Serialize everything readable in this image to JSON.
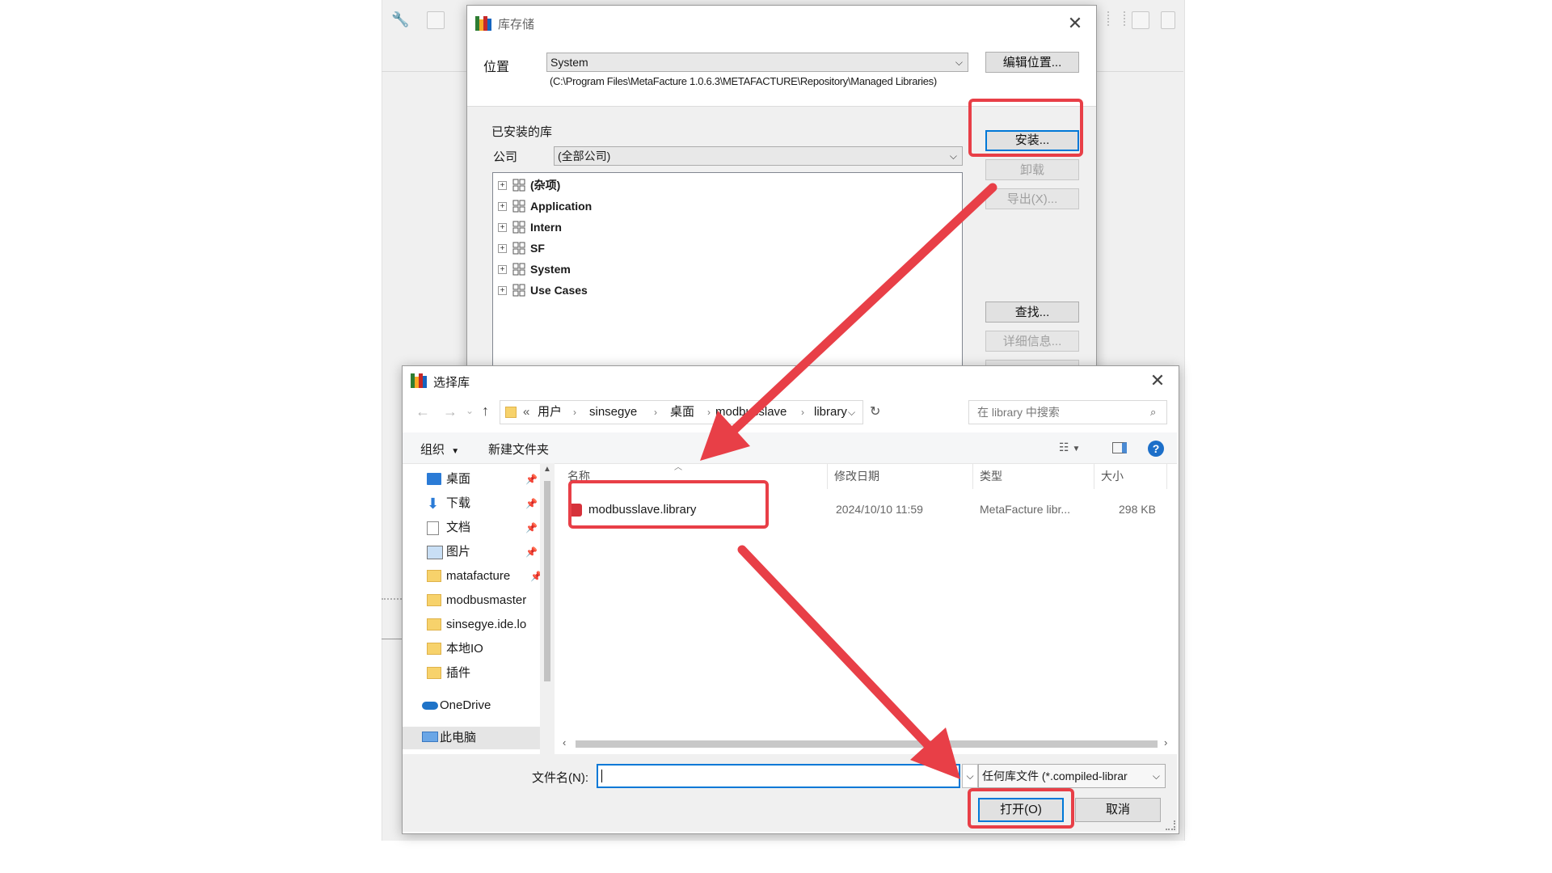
{
  "lib_dialog": {
    "title": "库存储",
    "location_label": "位置",
    "location_value": "System",
    "location_path": "(C:\\Program Files\\MetaFacture 1.0.6.3\\METAFACTURE\\Repository\\Managed Libraries)",
    "edit_location_button": "编辑位置...",
    "installed_group": "已安装的库",
    "company_label": "公司",
    "company_value": "(全部公司)",
    "install_button": "安装...",
    "uninstall_button": "卸载",
    "export_button": "导出(X)...",
    "find_button": "查找...",
    "details_button": "详细信息...",
    "tree_items": [
      {
        "label": "(杂项)"
      },
      {
        "label": "Application"
      },
      {
        "label": "Intern"
      },
      {
        "label": "SF"
      },
      {
        "label": "System"
      },
      {
        "label": "Use Cases"
      }
    ]
  },
  "file_dialog": {
    "title": "选择库",
    "breadcrumb": [
      "用户",
      "sinsegye",
      "桌面",
      "modbusslave",
      "library"
    ],
    "breadcrumb_prefix": "«",
    "search_placeholder": "在 library 中搜索",
    "organize_label": "组织",
    "new_folder_label": "新建文件夹",
    "nav_items": [
      {
        "label": "桌面",
        "pinned": true
      },
      {
        "label": "下载",
        "pinned": true
      },
      {
        "label": "文档",
        "pinned": true
      },
      {
        "label": "图片",
        "pinned": true
      },
      {
        "label": "matafacture",
        "pinned": true
      },
      {
        "label": "modbusmaster",
        "pinned": false
      },
      {
        "label": "sinsegye.ide.lo",
        "pinned": false
      },
      {
        "label": "本地IO",
        "pinned": false
      },
      {
        "label": "插件",
        "pinned": false
      }
    ],
    "onedrive_label": "OneDrive",
    "this_pc_label": "此电脑",
    "columns": {
      "name": "名称",
      "date": "修改日期",
      "type": "类型",
      "size": "大小"
    },
    "files": [
      {
        "name": "modbusslave.library",
        "date": "2024/10/10 11:59",
        "type": "MetaFacture libr...",
        "size": "298 KB"
      }
    ],
    "filename_label": "文件名(N):",
    "filename_value": "",
    "filter_value": "任何库文件 (*.compiled-librar",
    "open_button": "打开(O)",
    "cancel_button": "取消"
  },
  "colors": {
    "highlight": "#e83f47",
    "focus_blue": "#0078d7",
    "dialog_bg": "#f0f0f0"
  }
}
